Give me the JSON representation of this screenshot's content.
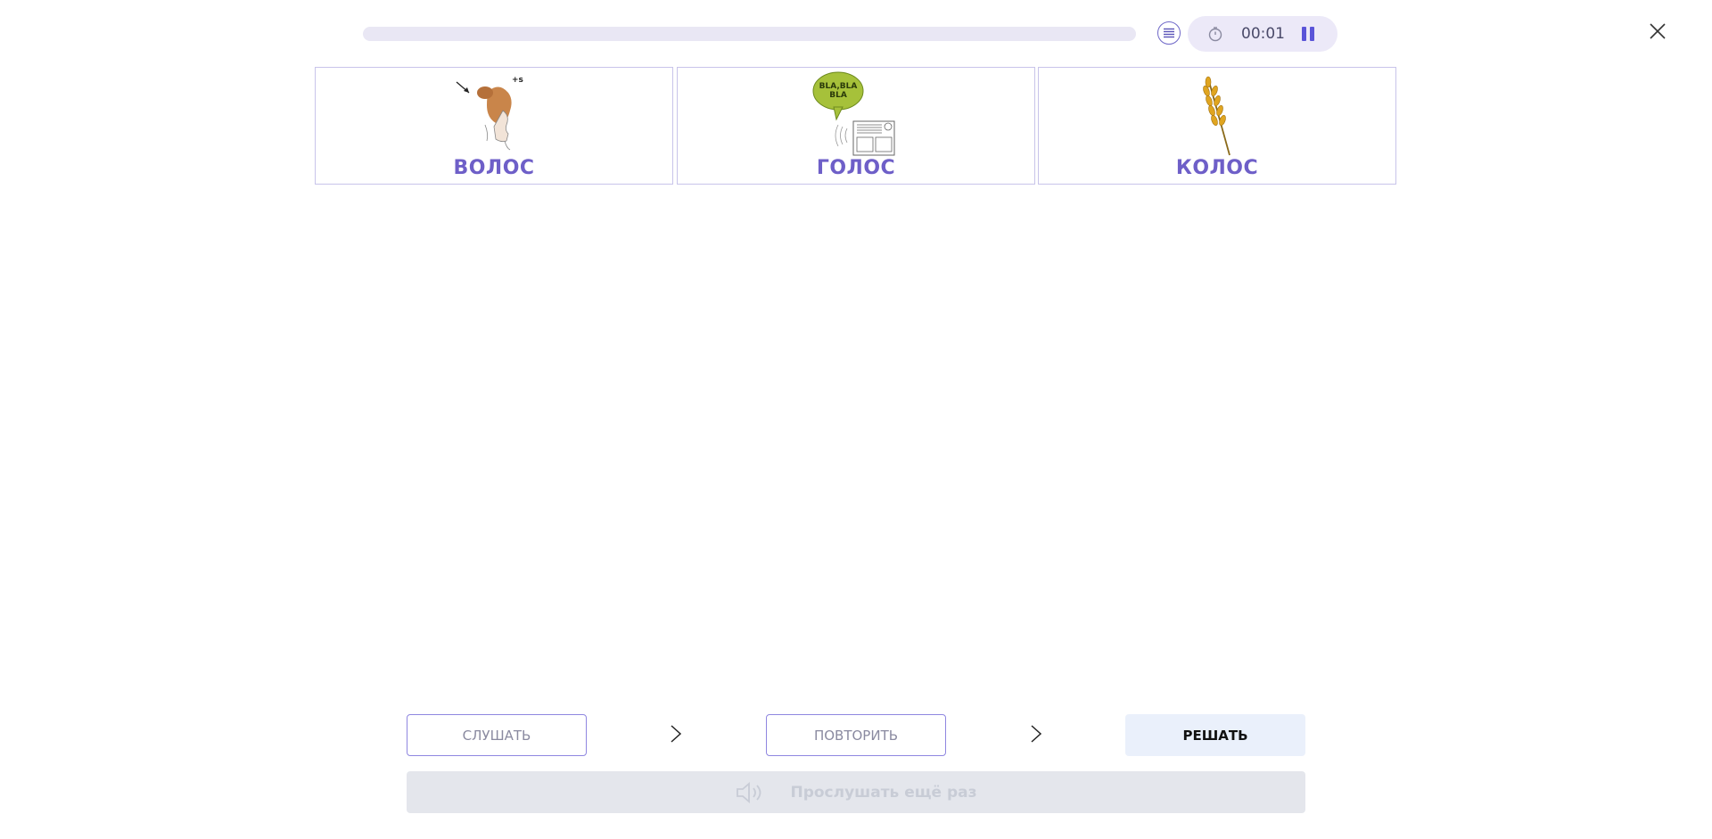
{
  "header": {
    "progress_fraction": 0,
    "timer": "00:01"
  },
  "cards": [
    {
      "label": "ВОЛОС",
      "image": "hair-illustration"
    },
    {
      "label": "ГОЛОС",
      "image": "voice-radio-illustration",
      "bubble_text": [
        "BLA,BLA",
        "BLA"
      ]
    },
    {
      "label": "КОЛОС",
      "image": "wheat-ear-illustration"
    }
  ],
  "hair_annotation": "+s",
  "steps": {
    "listen": "СЛУШАТЬ",
    "repeat": "ПОВТОРИТЬ",
    "solve": "РЕШАТЬ"
  },
  "listen_again": "Прослушать ещё раз",
  "colors": {
    "accent": "#6e5fc8",
    "card_border": "#c8c4ea",
    "progress_track": "#e9e7f4",
    "timer_bg": "#ece9f8",
    "primary_btn_bg": "#eaf0fb",
    "disabled_bg": "#e4e6ec"
  }
}
